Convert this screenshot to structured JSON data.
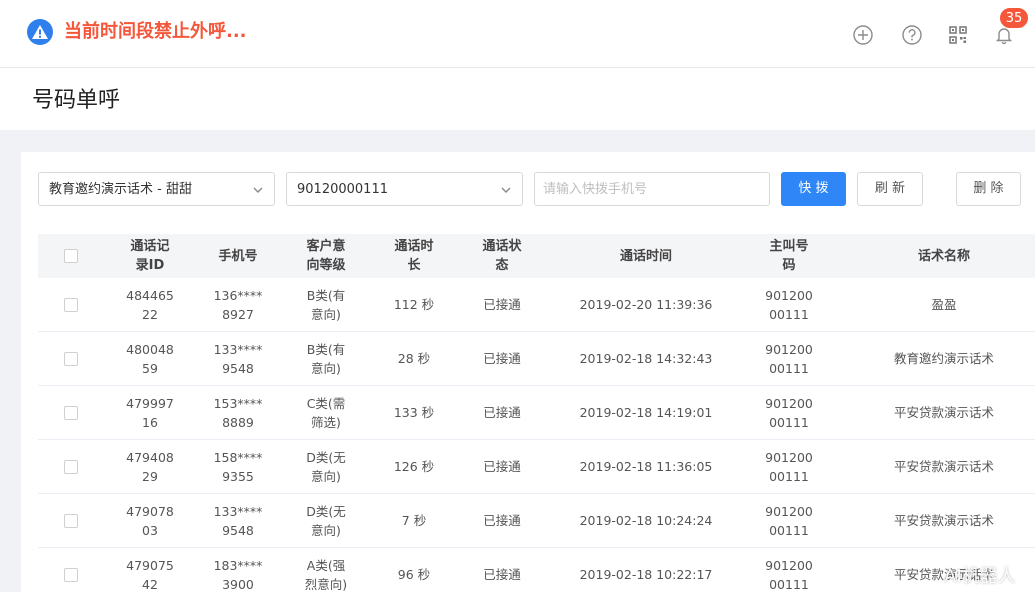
{
  "header": {
    "warning_text": "当前时间段禁止外呼...",
    "notification_count": "35",
    "icons": [
      "plus-circle-icon",
      "help-circle-icon",
      "qrcode-icon",
      "bell-icon"
    ]
  },
  "page": {
    "title": "号码单呼"
  },
  "toolbar": {
    "script_select_value": "教育邀约演示话术 - 甜甜",
    "number_select_value": "90120000111",
    "phone_input_placeholder": "请输入快拨手机号",
    "dial_label": "快 拨",
    "refresh_label": "刷 新",
    "delete_label": "删 除"
  },
  "table": {
    "headers": {
      "record_id": "通话记\n录ID",
      "phone": "手机号",
      "intent": "客户意\n向等级",
      "duration": "通话时\n长",
      "status": "通话状\n态",
      "time": "通话时间",
      "caller": "主叫号\n码",
      "script": "话术名称"
    },
    "rows": [
      {
        "record_id": "484465\n22",
        "phone": "136****\n8927",
        "intent": "B类(有\n意向)",
        "duration": "112 秒",
        "status": "已接通",
        "time": "2019-02-20 11:39:36",
        "caller": "901200\n00111",
        "script": "盈盈"
      },
      {
        "record_id": "480048\n59",
        "phone": "133****\n9548",
        "intent": "B类(有\n意向)",
        "duration": "28 秒",
        "status": "已接通",
        "time": "2019-02-18 14:32:43",
        "caller": "901200\n00111",
        "script": "教育邀约演示话术"
      },
      {
        "record_id": "479997\n16",
        "phone": "153****\n8889",
        "intent": "C类(需\n筛选)",
        "duration": "133 秒",
        "status": "已接通",
        "time": "2019-02-18 14:19:01",
        "caller": "901200\n00111",
        "script": "平安贷款演示话术"
      },
      {
        "record_id": "479408\n29",
        "phone": "158****\n9355",
        "intent": "D类(无\n意向)",
        "duration": "126 秒",
        "status": "已接通",
        "time": "2019-02-18 11:36:05",
        "caller": "901200\n00111",
        "script": "平安贷款演示话术"
      },
      {
        "record_id": "479078\n03",
        "phone": "133****\n9548",
        "intent": "D类(无\n意向)",
        "duration": "7 秒",
        "status": "已接通",
        "time": "2019-02-18 10:24:24",
        "caller": "901200\n00111",
        "script": "平安贷款演示话术"
      },
      {
        "record_id": "479075\n42",
        "phone": "183****\n3900",
        "intent": "A类(强\n烈意向)",
        "duration": "96 秒",
        "status": "已接通",
        "time": "2019-02-18 10:22:17",
        "caller": "901200\n00111",
        "script": "平安贷款演示话术"
      }
    ]
  },
  "watermark": "AI机器人",
  "colors": {
    "accent": "#2f86f6",
    "warning": "#f5573b",
    "badge": "#f5573b"
  }
}
